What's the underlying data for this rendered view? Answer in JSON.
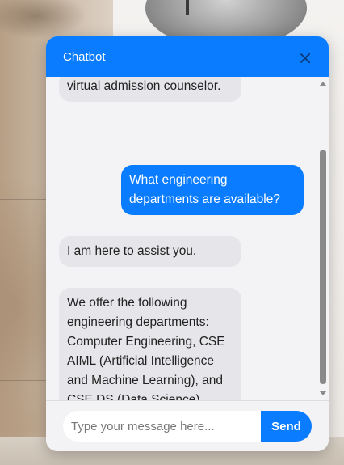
{
  "chat": {
    "title": "Chatbot",
    "close_icon": "close-icon"
  },
  "messages": [
    {
      "sender": "bot",
      "text": "virtual admission counselor."
    },
    {
      "sender": "user",
      "text": "What engineering departments are available?"
    },
    {
      "sender": "bot",
      "text": "I am here to assist you."
    },
    {
      "sender": "bot",
      "text": "We offer the following engineering departments: Computer Engineering, CSE AIML (Artificial Intelligence and Machine Learning), and CSE DS (Data Science)."
    }
  ],
  "composer": {
    "placeholder": "Type your message here...",
    "send_label": "Send"
  },
  "colors": {
    "accent": "#0a7cff",
    "bot_bubble": "#e6e6ea",
    "panel_bg": "#f3f3f5"
  }
}
